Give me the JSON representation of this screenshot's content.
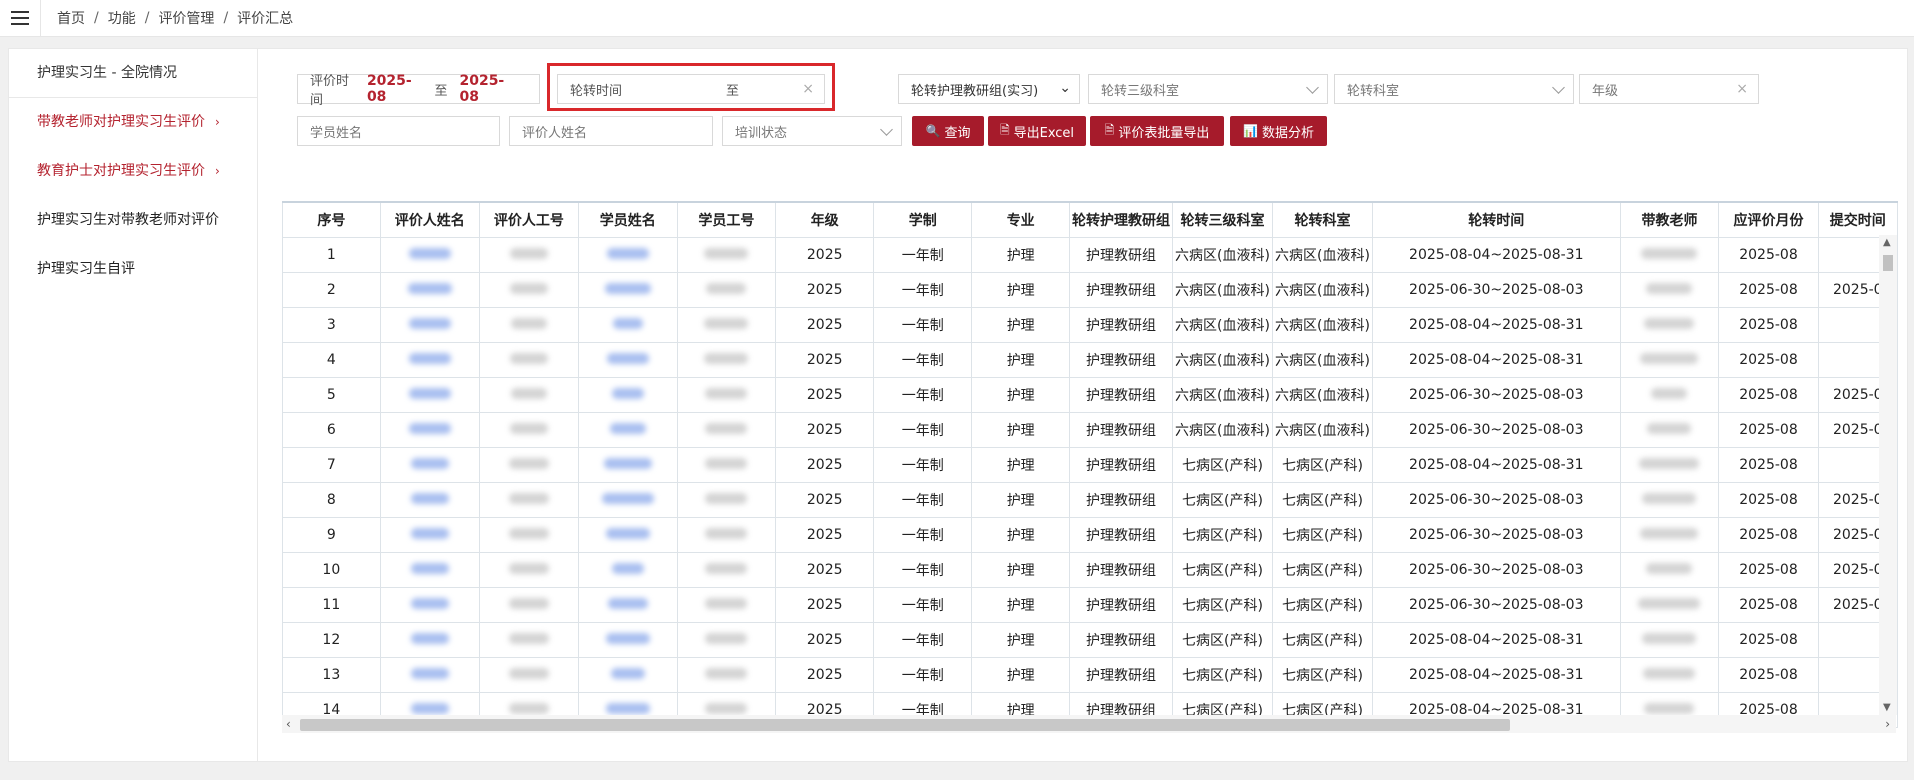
{
  "breadcrumb": {
    "home": "首页",
    "func": "功能",
    "manage": "评价管理",
    "current": "评价汇总",
    "sep": "/"
  },
  "sidebar": {
    "header": "护理实习生 - 全院情况",
    "items": [
      {
        "label": "带教老师对护理实习生评价",
        "chevron": "›"
      },
      {
        "label": "教育护士对护理实习生评价",
        "chevron": "›"
      },
      {
        "label": "护理实习生对带教老师对评价"
      },
      {
        "label": "护理实习生自评"
      }
    ]
  },
  "filters": {
    "eval_time_label": "评价时间",
    "eval_time_from": "2025-08",
    "eval_time_to_word": "至",
    "eval_time_to": "2025-08",
    "rotation_time_label": "轮转时间",
    "rotation_time_to_word": "至",
    "clear_glyph": "×",
    "group_select": "轮转护理教研组(实习)",
    "dept3_placeholder": "轮转三级科室",
    "dept_placeholder": "轮转科室",
    "grade_placeholder": "年级",
    "student_name_placeholder": "学员姓名",
    "evaluator_name_placeholder": "评价人姓名",
    "training_status_placeholder": "培训状态"
  },
  "buttons": {
    "query": "查询",
    "export_excel": "导出Excel",
    "batch_export": "评价表批量导出",
    "analysis": "数据分析"
  },
  "table": {
    "columns": [
      "序号",
      "评价人姓名",
      "评价人工号",
      "学员姓名",
      "学员工号",
      "年级",
      "学制",
      "专业",
      "轮转护理教研组",
      "轮转三级科室",
      "轮转科室",
      "轮转时间",
      "带教老师",
      "应评价月份",
      "提交时间"
    ],
    "rows": [
      [
        "1",
        "2025",
        "一年制",
        "护理",
        "护理教研组",
        "六病区(血液科)",
        "六病区(血液科)",
        "2025-08-04~2025-08-31",
        "2025-08",
        ""
      ],
      [
        "2",
        "2025",
        "一年制",
        "护理",
        "护理教研组",
        "六病区(血液科)",
        "六病区(血液科)",
        "2025-06-30~2025-08-03",
        "2025-08",
        "2025-0"
      ],
      [
        "3",
        "2025",
        "一年制",
        "护理",
        "护理教研组",
        "六病区(血液科)",
        "六病区(血液科)",
        "2025-08-04~2025-08-31",
        "2025-08",
        ""
      ],
      [
        "4",
        "2025",
        "一年制",
        "护理",
        "护理教研组",
        "六病区(血液科)",
        "六病区(血液科)",
        "2025-08-04~2025-08-31",
        "2025-08",
        ""
      ],
      [
        "5",
        "2025",
        "一年制",
        "护理",
        "护理教研组",
        "六病区(血液科)",
        "六病区(血液科)",
        "2025-06-30~2025-08-03",
        "2025-08",
        "2025-0"
      ],
      [
        "6",
        "2025",
        "一年制",
        "护理",
        "护理教研组",
        "六病区(血液科)",
        "六病区(血液科)",
        "2025-06-30~2025-08-03",
        "2025-08",
        "2025-0"
      ],
      [
        "7",
        "2025",
        "一年制",
        "护理",
        "护理教研组",
        "七病区(产科)",
        "七病区(产科)",
        "2025-08-04~2025-08-31",
        "2025-08",
        ""
      ],
      [
        "8",
        "2025",
        "一年制",
        "护理",
        "护理教研组",
        "七病区(产科)",
        "七病区(产科)",
        "2025-06-30~2025-08-03",
        "2025-08",
        "2025-0"
      ],
      [
        "9",
        "2025",
        "一年制",
        "护理",
        "护理教研组",
        "七病区(产科)",
        "七病区(产科)",
        "2025-06-30~2025-08-03",
        "2025-08",
        "2025-0"
      ],
      [
        "10",
        "2025",
        "一年制",
        "护理",
        "护理教研组",
        "七病区(产科)",
        "七病区(产科)",
        "2025-06-30~2025-08-03",
        "2025-08",
        "2025-0"
      ],
      [
        "11",
        "2025",
        "一年制",
        "护理",
        "护理教研组",
        "七病区(产科)",
        "七病区(产科)",
        "2025-06-30~2025-08-03",
        "2025-08",
        "2025-0"
      ],
      [
        "12",
        "2025",
        "一年制",
        "护理",
        "护理教研组",
        "七病区(产科)",
        "七病区(产科)",
        "2025-08-04~2025-08-31",
        "2025-08",
        ""
      ],
      [
        "13",
        "2025",
        "一年制",
        "护理",
        "护理教研组",
        "七病区(产科)",
        "七病区(产科)",
        "2025-08-04~2025-08-31",
        "2025-08",
        ""
      ],
      [
        "14",
        "2025",
        "一年制",
        "护理",
        "护理教研组",
        "七病区(产科)",
        "七病区(产科)",
        "2025-08-04~2025-08-31",
        "2025-08",
        ""
      ]
    ]
  },
  "scroll": {
    "left": "‹",
    "right": "›",
    "up": "▲",
    "down": "▼"
  },
  "colors": {
    "accent": "#a61b2b",
    "highlight": "#d9282b",
    "blur_blue": "#a9bff0",
    "blur_gray": "#d4d4d4"
  }
}
